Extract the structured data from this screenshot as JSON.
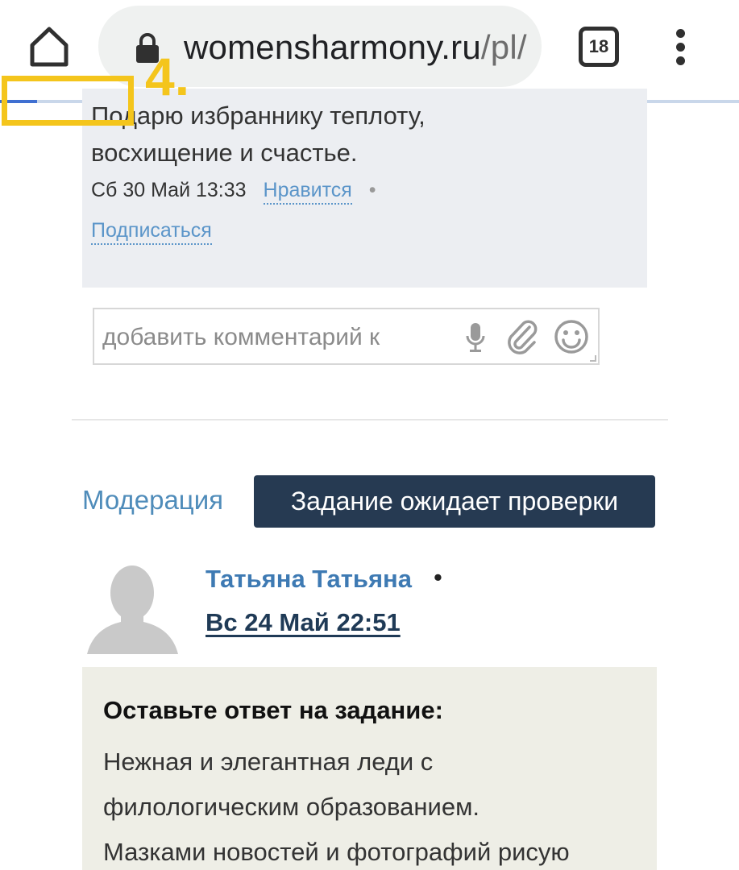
{
  "browser": {
    "url_domain": "womensharmony.ru",
    "url_path": "/pl/",
    "tab_count": "18",
    "page_load_progress": 0.05
  },
  "annotation": {
    "label": "4.",
    "color": "#f4c51c"
  },
  "comment": {
    "lines": [
      "Подарю избраннику теплоту,",
      "восхищение и счастье."
    ],
    "timestamp": "Сб 30 Май 13:33",
    "like_label": "Нравится",
    "bullet": "•",
    "subscribe_label": "Подписаться"
  },
  "comment_input": {
    "placeholder": "добавить комментарий к"
  },
  "moderation": {
    "label": "Модерация",
    "status": "Задание ожидает проверки"
  },
  "post": {
    "author": "Татьяна Татьяна",
    "bullet": "•",
    "date": "Вс 24 Май 22:51"
  },
  "answer": {
    "title": "Оставьте ответ на задание:",
    "lines": [
      "Нежная и элегантная леди с",
      "филологическим образованием.",
      "Мазками новостей и фотографий рисую"
    ]
  },
  "icons": [
    "home-icon",
    "lock-icon",
    "tabs-icon",
    "more-vert-icon",
    "mic-icon",
    "paperclip-icon",
    "smiley-icon",
    "avatar-placeholder"
  ],
  "colors": {
    "link": "#5b95c9",
    "status_button": "#263a52",
    "author": "#3e7ab3",
    "comment_card": "#eceef2",
    "answer_card": "#eeeee6"
  }
}
